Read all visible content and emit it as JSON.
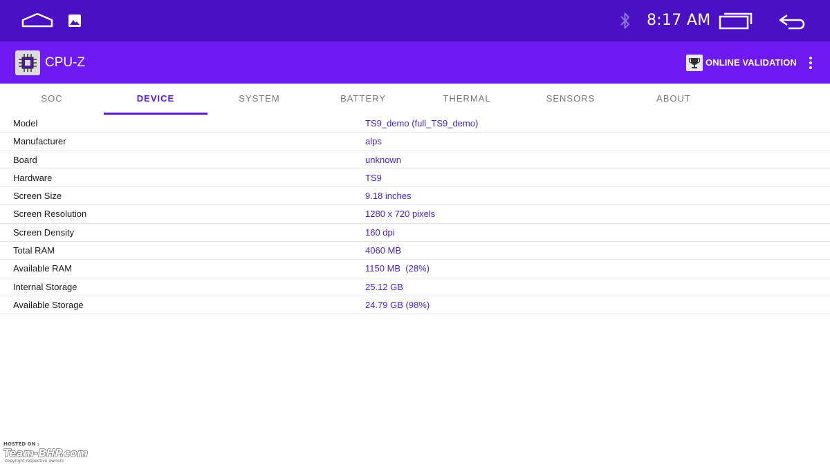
{
  "statusbar": {
    "time": "8:17 AM",
    "icons": [
      "home-icon",
      "gallery-icon",
      "bluetooth-icon",
      "recent-apps-icon",
      "back-icon"
    ]
  },
  "appbar": {
    "title": "CPU-Z",
    "validation_label": "ONLINE VALIDATION",
    "icons": [
      "cpu-chip-icon",
      "trophy-icon",
      "overflow-menu-icon"
    ]
  },
  "tabs": [
    {
      "label": "SOC",
      "active": false
    },
    {
      "label": "DEVICE",
      "active": true
    },
    {
      "label": "SYSTEM",
      "active": false
    },
    {
      "label": "BATTERY",
      "active": false
    },
    {
      "label": "THERMAL",
      "active": false
    },
    {
      "label": "SENSORS",
      "active": false
    },
    {
      "label": "ABOUT",
      "active": false
    }
  ],
  "device_info": [
    {
      "label": "Model",
      "value": "TS9_demo (full_TS9_demo)"
    },
    {
      "label": "Manufacturer",
      "value": "alps"
    },
    {
      "label": "Board",
      "value": "unknown"
    },
    {
      "label": "Hardware",
      "value": "TS9"
    },
    {
      "label": "Screen Size",
      "value": "9.18 inches"
    },
    {
      "label": "Screen Resolution",
      "value": "1280 x 720 pixels"
    },
    {
      "label": "Screen Density",
      "value": "160 dpi"
    },
    {
      "label": "Total RAM",
      "value": "4060 MB"
    },
    {
      "label": "Available RAM",
      "value": "1150 MB  (28%)"
    },
    {
      "label": "Internal Storage",
      "value": "25.12 GB"
    },
    {
      "label": "Available Storage",
      "value": "24.79 GB (98%)"
    }
  ],
  "watermark": {
    "line1": "HOSTED ON :",
    "line2": "Team-BHP.com",
    "line3": "copyright respective owners"
  },
  "colors": {
    "statusbar": "#4a10c4",
    "appbar": "#6e19f2",
    "accent": "#5a18d6",
    "value_text": "#4a1fb8"
  }
}
